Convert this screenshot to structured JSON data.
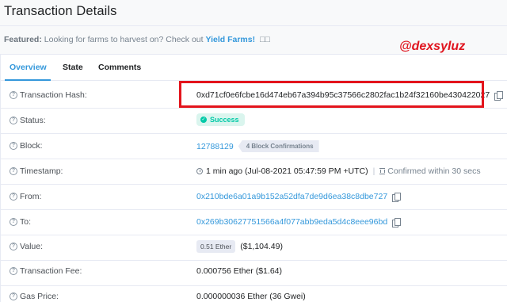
{
  "page": {
    "title": "Transaction Details"
  },
  "featured": {
    "prefix": "Featured:",
    "text": "Looking for farms to harvest on? Check out",
    "link": "Yield Farms!",
    "emoji": "□□"
  },
  "watermark": "@dexsyluz",
  "tabs": [
    {
      "label": "Overview",
      "active": true
    },
    {
      "label": "State",
      "active": false
    },
    {
      "label": "Comments",
      "active": false
    }
  ],
  "fields": {
    "hash": {
      "label": "Transaction Hash:",
      "value": "0xd71cf0e6fcbe16d474eb67a394b95c37566c2802fac1b24f32160be430422027",
      "icon": "copy-icon"
    },
    "status": {
      "label": "Status:",
      "value": "Success",
      "icon": "check-circle-icon"
    },
    "block": {
      "label": "Block:",
      "value": "12788129",
      "confirmations": "4 Block Confirmations"
    },
    "timestamp": {
      "label": "Timestamp:",
      "value": "1 min ago (Jul-08-2021 05:47:59 PM +UTC)",
      "separator": "|",
      "confirmed": "Confirmed within 30 secs"
    },
    "from": {
      "label": "From:",
      "value": "0x210bde6a01a9b152a52dfa7de9d6ea38c8dbe727",
      "icon": "copy-icon"
    },
    "to": {
      "label": "To:",
      "value": "0x269b30627751566a4f077abb9eda5d4c8eee96bd",
      "icon": "copy-icon"
    },
    "value": {
      "label": "Value:",
      "ether": "0.51 Ether",
      "usd": "($1,104.49)"
    },
    "fee": {
      "label": "Transaction Fee:",
      "value": "0.000756 Ether ($1.64)"
    },
    "gas": {
      "label": "Gas Price:",
      "value": "0.000000036 Ether (36 Gwei)"
    }
  },
  "colors": {
    "link": "#3498db",
    "success": "#00c9a7",
    "highlight": "#e3141c",
    "watermark": "#e0141e"
  }
}
